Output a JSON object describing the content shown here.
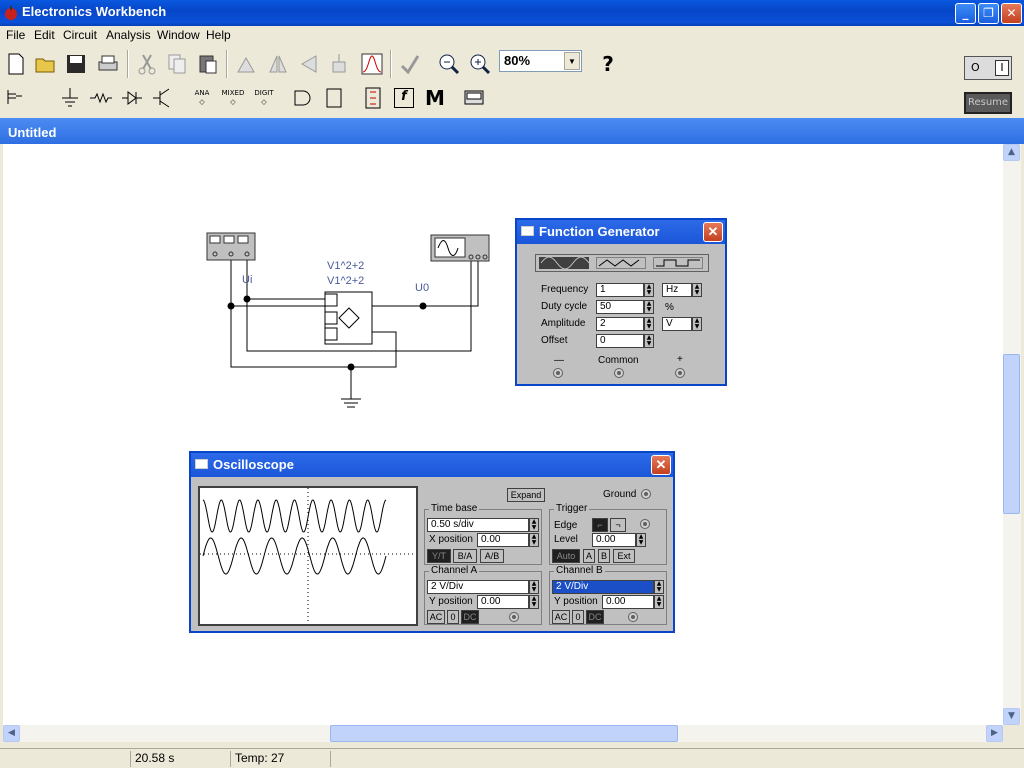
{
  "app": {
    "title": "Electronics Workbench"
  },
  "menu": {
    "items": [
      "File",
      "Edit",
      "Circuit",
      "Analysis",
      "Window",
      "Help"
    ]
  },
  "toolbar": {
    "zoom_value": "80%",
    "help_label": "?"
  },
  "toolbar2": {
    "bins": [
      "ANA",
      "MIXED",
      "DIGIT"
    ],
    "m_label": "M",
    "f_label": "f"
  },
  "power": {
    "label_off": "O",
    "label_on": "I"
  },
  "resume_label": "Resume",
  "document": {
    "title": "Untitled"
  },
  "circuit": {
    "multiplier_label_1": "V1^2+2",
    "multiplier_label_2": "V1^2+2",
    "input_label": "Ui",
    "output_label": "U0"
  },
  "func_gen": {
    "title": "Function Generator",
    "frequency_label": "Frequency",
    "frequency_value": "1",
    "frequency_unit": "Hz",
    "duty_label": "Duty cycle",
    "duty_value": "50",
    "duty_unit": "%",
    "amplitude_label": "Amplitude",
    "amplitude_value": "2",
    "amplitude_unit": "V",
    "offset_label": "Offset",
    "offset_value": "0",
    "minus_label": "—",
    "common_label": "Common",
    "plus_label": "+"
  },
  "scope": {
    "title": "Oscilloscope",
    "expand_label": "Expand",
    "ground_label": "Ground",
    "timebase_label": "Time base",
    "timebase_value": "0.50 s/div",
    "xpos_label": "X position",
    "xpos_value": "0.00",
    "mode_buttons": [
      "Y/T",
      "B/A",
      "A/B"
    ],
    "trigger_label": "Trigger",
    "edge_label": "Edge",
    "level_label": "Level",
    "level_value": "0.00",
    "trigger_buttons": [
      "Auto",
      "A",
      "B",
      "Ext"
    ],
    "chA_label": "Channel A",
    "chA_value": "2  V/Div",
    "chA_ypos_label": "Y position",
    "chA_ypos_value": "0.00",
    "chB_label": "Channel B",
    "chB_value": "2  V/Div",
    "chB_ypos_label": "Y position",
    "chB_ypos_value": "0.00",
    "coupling": [
      "AC",
      "0",
      "DC"
    ]
  },
  "status": {
    "time": "20.58 s",
    "temp": "Temp:  27"
  }
}
